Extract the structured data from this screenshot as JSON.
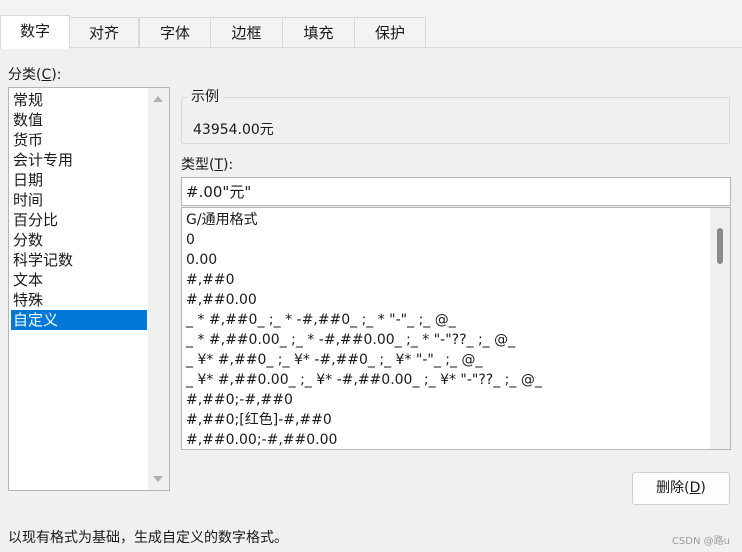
{
  "tabs": [
    {
      "label": "数字",
      "active": true
    },
    {
      "label": "对齐",
      "active": false
    },
    {
      "label": "字体",
      "active": false
    },
    {
      "label": "边框",
      "active": false
    },
    {
      "label": "填充",
      "active": false
    },
    {
      "label": "保护",
      "active": false
    }
  ],
  "category": {
    "label_text": "分类(",
    "label_hotkey": "C",
    "label_tail": "):",
    "items": [
      "常规",
      "数值",
      "货币",
      "会计专用",
      "日期",
      "时间",
      "百分比",
      "分数",
      "科学记数",
      "文本",
      "特殊",
      "自定义"
    ],
    "selected": "自定义"
  },
  "sample": {
    "legend": "示例",
    "value": "43954.00元"
  },
  "type": {
    "label_text": "类型(",
    "label_hotkey": "T",
    "label_tail": "):",
    "value": "#.00\"元\""
  },
  "formats": [
    "G/通用格式",
    "0",
    "0.00",
    "#,##0",
    "#,##0.00",
    "_ * #,##0_ ;_ * -#,##0_ ;_ * \"-\"_ ;_ @_",
    "_ * #,##0.00_ ;_ * -#,##0.00_ ;_ * \"-\"??_ ;_ @_",
    "_ ¥* #,##0_ ;_ ¥* -#,##0_ ;_ ¥* \"-\"_ ;_ @_",
    "_ ¥* #,##0.00_ ;_ ¥* -#,##0.00_ ;_ ¥* \"-\"??_ ;_ @_",
    "#,##0;-#,##0",
    "#,##0;[红色]-#,##0",
    "#,##0.00;-#,##0.00"
  ],
  "delete_button": {
    "label_text": "删除(",
    "label_hotkey": "D",
    "label_tail": ")"
  },
  "description": "以现有格式为基础，生成自定义的数字格式。",
  "watermark": "CSDN @路u",
  "colors": {
    "selection": "#0078d7",
    "dialog_bg": "#f0f0f0",
    "list_bg": "#ffffff"
  }
}
